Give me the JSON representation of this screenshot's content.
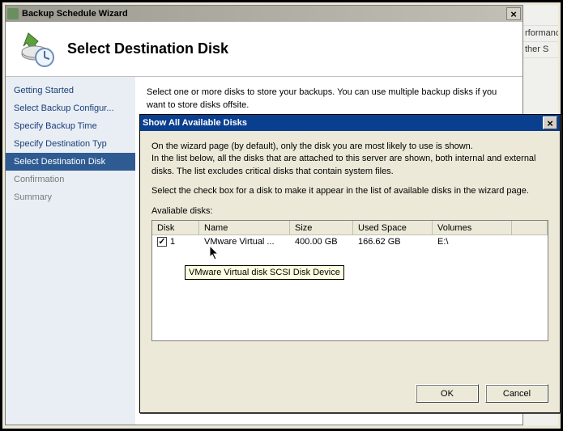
{
  "bg": {
    "item1": "rformanc",
    "item2": "ther S"
  },
  "wizard": {
    "windowTitle": "Backup Schedule Wizard",
    "headerTitle": "Select Destination Disk",
    "instruction": "Select one or more disks to store your backups. You can use multiple backup disks if you want to store disks offsite.",
    "nav": [
      "Getting Started",
      "Select Backup Configur...",
      "Specify Backup Time",
      "Specify Destination Typ",
      "Select Destination Disk",
      "Confirmation",
      "Summary"
    ]
  },
  "dialog": {
    "title": "Show All Available Disks",
    "p1": "On the wizard page (by default), only the disk you are most likely to use is shown.",
    "p2": "In the list below, all the disks that are attached to this server are shown, both internal and external disks. The list excludes critical disks that contain system files.",
    "p3": "Select the check box for a disk to make it appear in the list of available disks in the wizard page.",
    "availLabel": "Avaliable disks:",
    "columns": {
      "disk": "Disk",
      "name": "Name",
      "size": "Size",
      "used": "Used Space",
      "vol": "Volumes"
    },
    "row": {
      "disk": "1",
      "name": "VMware Virtual ...",
      "size": "400.00 GB",
      "used": "166.62 GB",
      "vol": "E:\\"
    },
    "tooltip": "VMware Virtual disk SCSI Disk Device",
    "ok": "OK",
    "cancel": "Cancel"
  }
}
